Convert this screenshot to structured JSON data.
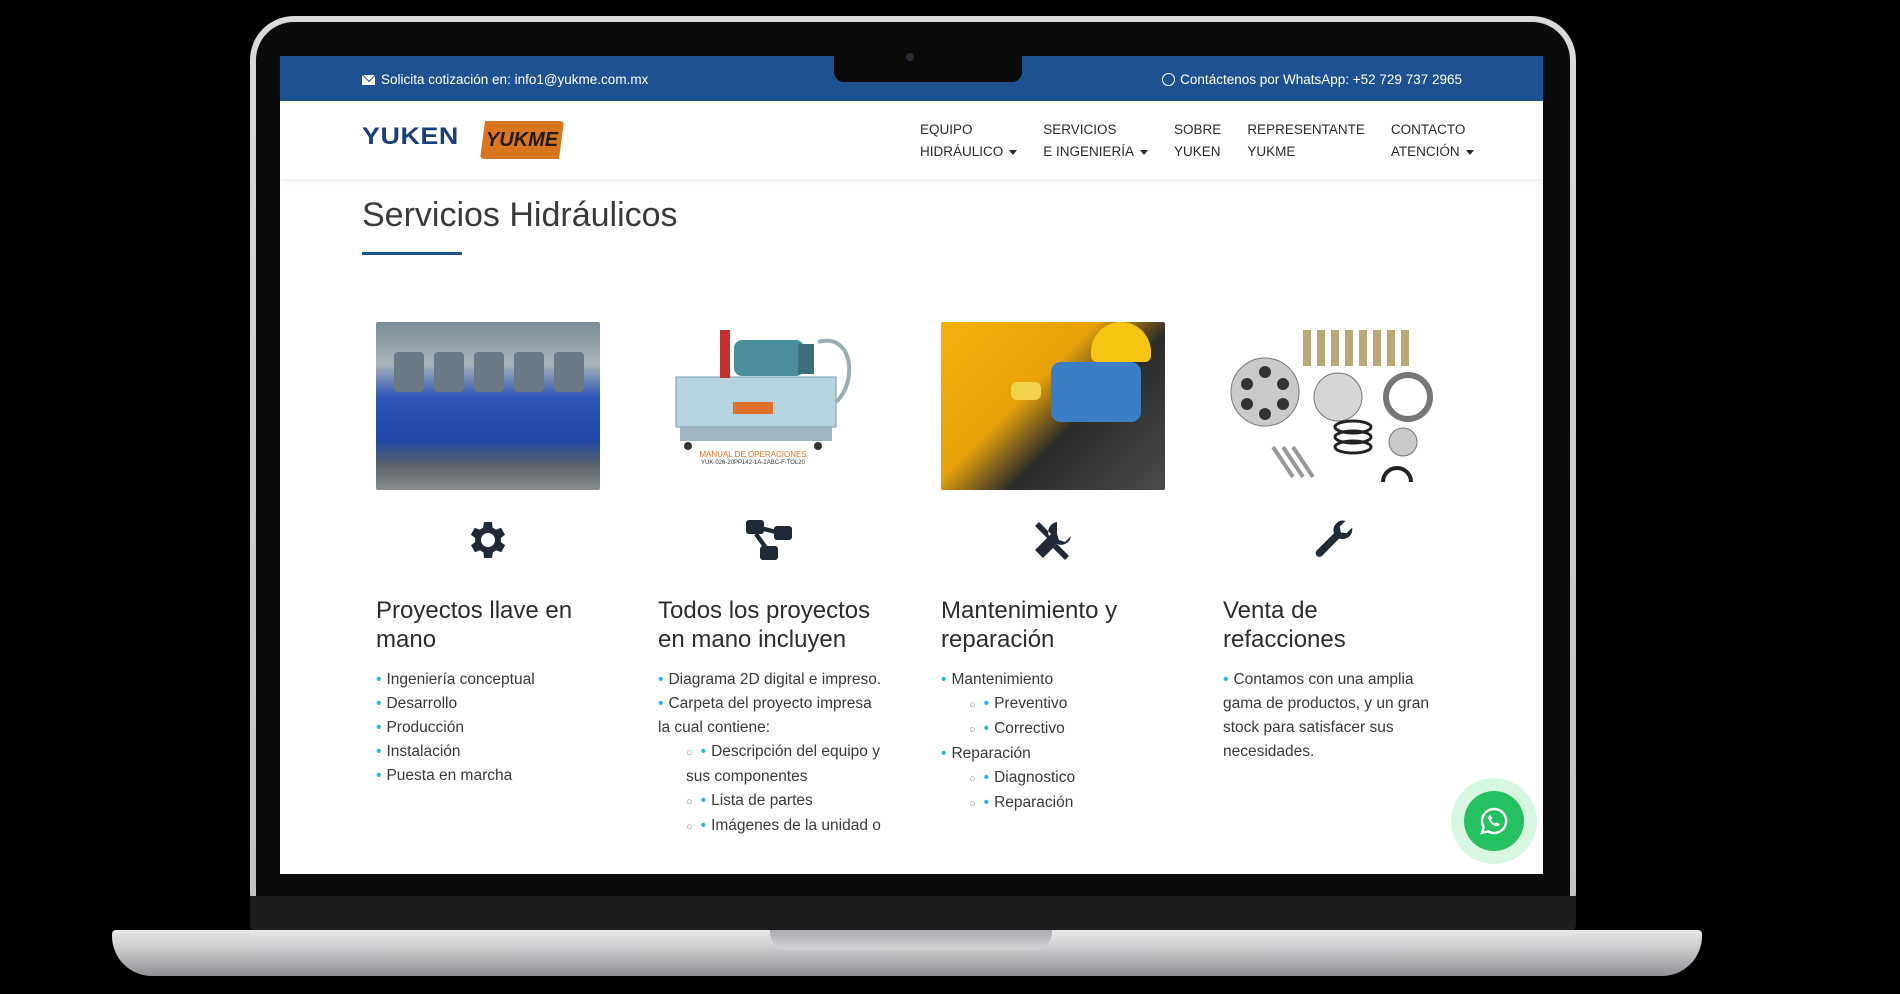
{
  "topbar": {
    "quote_text": "Solicita cotización en: info1@yukme.com.mx",
    "whatsapp_text": "Contáctenos por WhatsApp: +52 729 737 2965"
  },
  "logos": {
    "yuken": "YUKEN",
    "yukme": "YUKME"
  },
  "nav": [
    {
      "line1": "EQUIPO",
      "line2": "HIDRÁULICO",
      "dropdown": true
    },
    {
      "line1": "SERVICIOS",
      "line2": "E INGENIERÍA",
      "dropdown": true
    },
    {
      "line1": "SOBRE",
      "line2": "YUKEN",
      "dropdown": false
    },
    {
      "line1": "REPRESENTANTE",
      "line2": "YUKME",
      "dropdown": false
    },
    {
      "line1": "CONTACTO",
      "line2": "ATENCIÓN",
      "dropdown": true
    }
  ],
  "page": {
    "title": "Servicios Hidráulicos"
  },
  "columns": [
    {
      "icon": "gear-icon",
      "heading": "Proyectos llave en mano",
      "items": [
        "Ingeniería conceptual",
        "Desarrollo",
        "Producción",
        "Instalación",
        "Puesta en marcha"
      ]
    },
    {
      "icon": "sitemap-icon",
      "heading": "Todos los proyectos en mano incluyen",
      "photo_caption": "MANUAL DE OPERACIONES",
      "photo_code": "YUK-026-20PP142-1A-2ABC-F-TOL20",
      "items": [
        "Diagrama 2D digital e impreso.",
        "Carpeta del proyecto impresa la cual contiene:"
      ],
      "subitems": [
        "Descripción del equipo y sus componentes",
        "Lista de partes",
        "Imágenes de la unidad o"
      ]
    },
    {
      "icon": "tools-icon",
      "heading": "Mantenimiento y reparación",
      "groups": [
        {
          "label": "Mantenimiento",
          "sub": [
            "Preventivo",
            "Correctivo"
          ]
        },
        {
          "label": "Reparación",
          "sub": [
            "Diagnostico",
            "Reparación"
          ]
        }
      ]
    },
    {
      "icon": "wrench-icon",
      "heading": "Venta de refacciones",
      "desc": "Contamos con una amplia gama de productos, y un gran stock para satisfacer sus necesidades."
    }
  ],
  "colors": {
    "topbar": "#1c5192",
    "bullet": "#2fb5d8",
    "whatsapp": "#25c160"
  }
}
